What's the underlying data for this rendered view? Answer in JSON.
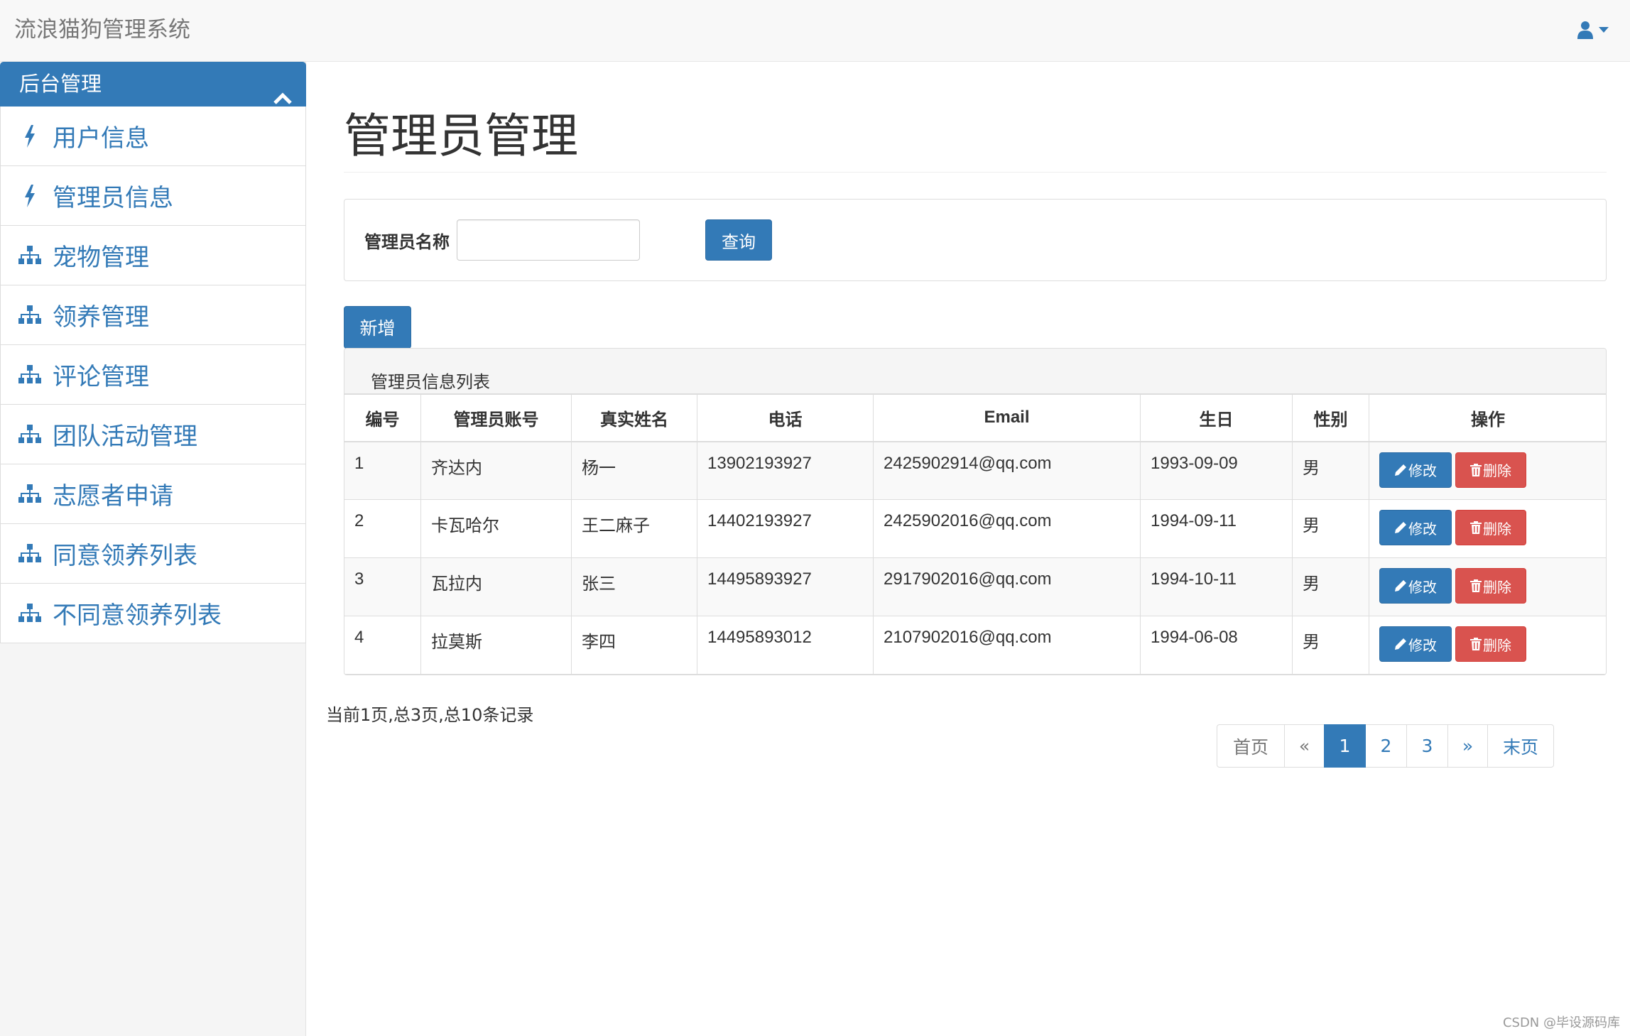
{
  "app": {
    "title": "流浪猫狗管理系统",
    "user_icon": "user-icon",
    "dropdown_icon": "caret-down-icon"
  },
  "sidebar": {
    "panel_title": "后台管理",
    "collapse_icon": "chevron-up-icon",
    "items": [
      {
        "label": "用户信息",
        "icon": "flash-icon"
      },
      {
        "label": "管理员信息",
        "icon": "flash-icon"
      },
      {
        "label": "宠物管理",
        "icon": "sitemap-icon"
      },
      {
        "label": "领养管理",
        "icon": "sitemap-icon"
      },
      {
        "label": "评论管理",
        "icon": "sitemap-icon"
      },
      {
        "label": "团队活动管理",
        "icon": "sitemap-icon"
      },
      {
        "label": "志愿者申请",
        "icon": "sitemap-icon"
      },
      {
        "label": "同意领养列表",
        "icon": "sitemap-icon"
      },
      {
        "label": "不同意领养列表",
        "icon": "sitemap-icon"
      }
    ]
  },
  "main": {
    "page_title": "管理员管理",
    "search": {
      "label": "管理员名称",
      "value": "",
      "placeholder": "",
      "button": "查询"
    },
    "add_button": "新增",
    "table": {
      "heading": "管理员信息列表",
      "columns": [
        "编号",
        "管理员账号",
        "真实姓名",
        "电话",
        "Email",
        "生日",
        "性别",
        "操作"
      ],
      "rows": [
        {
          "id": "1",
          "account": "齐达内",
          "name": "杨一",
          "phone": "13902193927",
          "email": "2425902914@qq.com",
          "birthday": "1993-09-09",
          "gender": "男"
        },
        {
          "id": "2",
          "account": "卡瓦哈尔",
          "name": "王二麻子",
          "phone": "14402193927",
          "email": "2425902016@qq.com",
          "birthday": "1994-09-11",
          "gender": "男"
        },
        {
          "id": "3",
          "account": "瓦拉内",
          "name": "张三",
          "phone": "14495893927",
          "email": "2917902016@qq.com",
          "birthday": "1994-10-11",
          "gender": "男"
        },
        {
          "id": "4",
          "account": "拉莫斯",
          "name": "李四",
          "phone": "14495893012",
          "email": "2107902016@qq.com",
          "birthday": "1994-06-08",
          "gender": "男"
        }
      ],
      "edit_label": "修改",
      "delete_label": "删除",
      "edit_icon": "pencil-icon",
      "delete_icon": "trash-icon"
    },
    "summary": "当前1页,总3页,总10条记录",
    "pagination": {
      "first": "首页",
      "prev": "«",
      "pages": [
        "1",
        "2",
        "3"
      ],
      "current": "1",
      "next": "»",
      "last": "末页"
    }
  },
  "watermark": "CSDN @毕设源码库",
  "colors": {
    "primary": "#337ab7",
    "danger": "#d9534f",
    "navbar_bg": "#f8f8f8",
    "sidebar_bg": "#f5f5f5"
  }
}
